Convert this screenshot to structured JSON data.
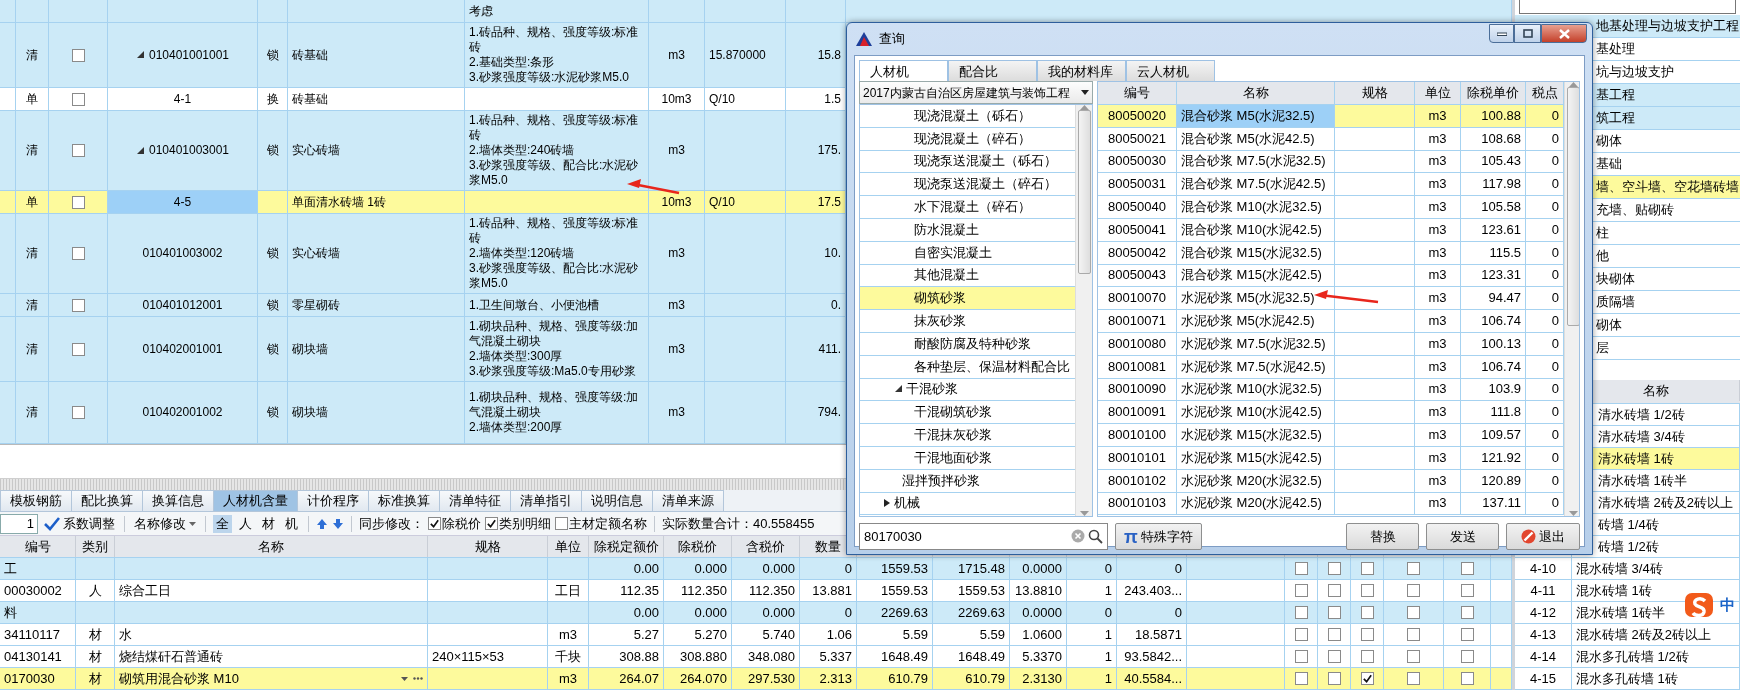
{
  "top_grid": {
    "rows": [
      {
        "kind": "bill",
        "selected": false,
        "features": [
          "考虑"
        ]
      },
      {
        "kind": "bill",
        "selected": false,
        "type": "清",
        "checked": false,
        "expanded": true,
        "code": "010401001001",
        "lock": "锁",
        "name": "砖基础",
        "features": [
          "1.砖品种、规格、强度等级:标准砖",
          "2.基础类型:条形",
          "3.砂浆强度等级:水泥砂浆M5.0"
        ],
        "unit": "m3",
        "expr": "15.870000",
        "qty": "15.8"
      },
      {
        "kind": "quota",
        "selected": false,
        "type": "单",
        "checked": false,
        "code": "4-1",
        "lock": "换",
        "name": "砖基础",
        "unit": "10m3",
        "expr": "Q/10",
        "qty": "1.5"
      },
      {
        "kind": "bill",
        "selected": false,
        "type": "清",
        "checked": false,
        "expanded": true,
        "code": "010401003001",
        "lock": "锁",
        "name": "实心砖墙",
        "features": [
          "1.砖品种、规格、强度等级:标准砖",
          "2.墙体类型:240砖墙",
          "3.砂浆强度等级、配合比:水泥砂浆M5.0"
        ],
        "unit": "m3",
        "qty": "175."
      },
      {
        "kind": "quota",
        "selected": true,
        "type": "单",
        "checked": false,
        "code": "4-5",
        "name": "单面清水砖墙 1砖",
        "unit": "10m3",
        "expr": "Q/10",
        "qty": "17.5"
      },
      {
        "kind": "bill",
        "selected": false,
        "type": "清",
        "checked": false,
        "expanded": false,
        "code": "010401003002",
        "lock": "锁",
        "name": "实心砖墙",
        "features": [
          "1.砖品种、规格、强度等级:标准砖",
          "2.墙体类型:120砖墙",
          "3.砂浆强度等级、配合比:水泥砂浆M5.0"
        ],
        "unit": "m3",
        "qty": "10."
      },
      {
        "kind": "bill",
        "selected": false,
        "type": "清",
        "checked": false,
        "expanded": false,
        "code": "010401012001",
        "lock": "锁",
        "name": "零星砌砖",
        "features": [
          "1.卫生间墩台、小便池槽"
        ],
        "unit": "m3",
        "qty": "0."
      },
      {
        "kind": "bill",
        "selected": false,
        "type": "清",
        "checked": false,
        "expanded": false,
        "code": "010402001001",
        "lock": "锁",
        "name": "砌块墙",
        "features": [
          "1.砌块品种、规格、强度等级:加气混凝土砌块",
          "2.墙体类型:300厚",
          "3.砂浆强度等级:Ma5.0专用砂浆"
        ],
        "unit": "m3",
        "qty": "411."
      },
      {
        "kind": "bill",
        "selected": false,
        "type": "清",
        "checked": false,
        "expanded": false,
        "code": "010402001002",
        "lock": "锁",
        "name": "砌块墙",
        "features": [
          "1.砌块品种、规格、强度等级:加气混凝土砌块",
          "2.墙体类型:200厚"
        ],
        "unit": "m3",
        "qty": "794."
      }
    ]
  },
  "bottom_tabs": [
    {
      "label": "模板钢筋",
      "selected": false
    },
    {
      "label": "配比换算",
      "selected": false
    },
    {
      "label": "换算信息",
      "selected": false
    },
    {
      "label": "人材机含量",
      "selected": true
    },
    {
      "label": "计价程序",
      "selected": false
    },
    {
      "label": "标准换算",
      "selected": false
    },
    {
      "label": "清单特征",
      "selected": false
    },
    {
      "label": "清单指引",
      "selected": false
    },
    {
      "label": "说明信息",
      "selected": false
    },
    {
      "label": "清单来源",
      "selected": false
    }
  ],
  "toolbar": {
    "coefficient": "1",
    "coefficient_button": "系数调整",
    "rename_menu": "名称修改",
    "filters": [
      {
        "label": "全",
        "selected": true
      },
      {
        "label": "人",
        "selected": false
      },
      {
        "label": "材",
        "selected": false
      },
      {
        "label": "机",
        "selected": false
      }
    ],
    "sync_label": "同步修改：",
    "sync_options": [
      {
        "label": "除税价",
        "checked": true
      },
      {
        "label": "类别明细",
        "checked": true
      },
      {
        "label": "主材定额名称",
        "checked": false
      }
    ],
    "total": "实际数量合计：40.558455"
  },
  "detail_table": {
    "columns": [
      "编号",
      "类别",
      "名称",
      "规格",
      "单位",
      "除税定额价",
      "除税价",
      "含税价",
      "数量"
    ],
    "rows": [
      {
        "kind": "group",
        "selected": false,
        "code": "工",
        "base_price": "0.00",
        "price": "0.000",
        "tax_price": "0.000",
        "qty": "0",
        "column_10": "1559.53",
        "column_11": "1715.48",
        "column_12": "0.0000",
        "column_13": "0",
        "column_14": "0",
        "checks": [
          false,
          false,
          false,
          false,
          false
        ]
      },
      {
        "kind": "item",
        "selected": false,
        "code": "00030002",
        "type": "人",
        "name": "综合工日",
        "unit": "工日",
        "base_price": "112.35",
        "price": "112.350",
        "tax_price": "112.350",
        "qty": "13.881",
        "column_10": "1559.53",
        "column_11": "1559.53",
        "column_12": "13.8810",
        "column_13": "1",
        "column_14": "243.403...",
        "checks": [
          false,
          false,
          false,
          false,
          false
        ]
      },
      {
        "kind": "group",
        "selected": false,
        "code": "料",
        "base_price": "0.00",
        "price": "0.000",
        "tax_price": "0.000",
        "qty": "0",
        "column_10": "2269.63",
        "column_11": "2269.63",
        "column_12": "0.0000",
        "column_13": "0",
        "column_14": "0",
        "checks": [
          false,
          false,
          false,
          false,
          false
        ]
      },
      {
        "kind": "item",
        "selected": false,
        "code": "34110117",
        "type": "材",
        "name": "水",
        "unit": "m3",
        "base_price": "5.27",
        "price": "5.270",
        "tax_price": "5.740",
        "qty": "1.06",
        "column_10": "5.59",
        "column_11": "5.59",
        "column_12": "1.0600",
        "column_13": "1",
        "column_14": "18.5871",
        "checks": [
          false,
          false,
          false,
          false,
          false
        ]
      },
      {
        "kind": "item",
        "selected": false,
        "code": "04130141",
        "type": "材",
        "name": "烧结煤矸石普通砖",
        "spec": "240×115×53",
        "unit": "千块",
        "base_price": "308.88",
        "price": "308.880",
        "tax_price": "348.080",
        "qty": "5.337",
        "column_10": "1648.49",
        "column_11": "1648.49",
        "column_12": "5.3370",
        "column_13": "1",
        "column_14": "93.5842...",
        "checks": [
          false,
          false,
          false,
          false,
          false
        ]
      },
      {
        "kind": "item",
        "selected": true,
        "code": "0170030",
        "type": "材",
        "name": "砌筑用混合砂浆 M10",
        "unit": "m3",
        "base_price": "264.07",
        "price": "264.070",
        "tax_price": "297.530",
        "qty": "2.313",
        "column_10": "610.79",
        "column_11": "610.79",
        "column_12": "2.3130",
        "column_13": "1",
        "column_14": "40.5584...",
        "checks": [
          false,
          false,
          true,
          false,
          false
        ]
      }
    ]
  },
  "side_tree": [
    {
      "kind": "chapter",
      "selected": false,
      "label": "地基处理与边坡支护工程"
    },
    {
      "kind": "item",
      "selected": false,
      "label": "基处理"
    },
    {
      "kind": "item",
      "selected": false,
      "label": "坑与边坡支护"
    },
    {
      "kind": "chapter",
      "selected": false,
      "label": "基工程"
    },
    {
      "kind": "chapter",
      "selected": false,
      "label": "筑工程"
    },
    {
      "kind": "item",
      "selected": false,
      "label": "砌体"
    },
    {
      "kind": "item",
      "selected": false,
      "label": "基础"
    },
    {
      "kind": "item",
      "selected": true,
      "label": "墙、空斗墙、空花墙砖墙"
    },
    {
      "kind": "item",
      "selected": false,
      "label": "充墙、贴砌砖"
    },
    {
      "kind": "item",
      "selected": false,
      "label": "柱"
    },
    {
      "kind": "item",
      "selected": false,
      "label": "他"
    },
    {
      "kind": "item",
      "selected": false,
      "label": "块砌体"
    },
    {
      "kind": "item",
      "selected": false,
      "label": "质隔墙"
    },
    {
      "kind": "item",
      "selected": false,
      "label": "砌体"
    },
    {
      "kind": "item",
      "selected": false,
      "label": "层"
    }
  ],
  "side_table": {
    "columns": [
      "名称"
    ],
    "rows": [
      {
        "selected": false,
        "name": "清水砖墙 1/2砖"
      },
      {
        "selected": false,
        "name": "清水砖墙 3/4砖"
      },
      {
        "selected": true,
        "name": "清水砖墙 1砖"
      },
      {
        "selected": false,
        "name": "清水砖墙 1砖半"
      },
      {
        "selected": false,
        "name": "清水砖墙 2砖及2砖以上"
      },
      {
        "selected": false,
        "name": "砖墙 1/4砖"
      },
      {
        "selected": false,
        "name": "砖墙 1/2砖"
      },
      {
        "selected": false,
        "code": "4-10",
        "name": "混水砖墙 3/4砖"
      },
      {
        "selected": false,
        "code": "4-11",
        "name": "混水砖墙 1砖"
      },
      {
        "selected": false,
        "code": "4-12",
        "name": "混水砖墙 1砖半"
      },
      {
        "selected": false,
        "code": "4-13",
        "name": "混水砖墙 2砖及2砖以上"
      },
      {
        "selected": false,
        "code": "4-14",
        "name": "混水多孔砖墙 1/2砖"
      },
      {
        "selected": false,
        "code": "4-15",
        "name": "混水多孔砖墙 1砖"
      }
    ]
  },
  "ime": {
    "mode": "中"
  },
  "dialog": {
    "title": "查询",
    "tabs": [
      {
        "label": "人材机",
        "selected": true
      },
      {
        "label": "配合比",
        "selected": false
      },
      {
        "label": "我的材料库",
        "selected": false
      },
      {
        "label": "云人材机",
        "selected": false
      }
    ],
    "library": "2017内蒙古自治区房屋建筑与装饰工程",
    "tree": [
      {
        "children": [
          {
            "children": [
              {
                "label": "现浇混凝土（砾石）",
                "selected": false
              },
              {
                "label": "现浇混凝土（碎石）",
                "selected": false
              },
              {
                "label": "现浇泵送混凝土（砾石）",
                "selected": false
              },
              {
                "label": "现浇泵送混凝土（碎石）",
                "selected": false
              },
              {
                "label": "水下混凝土（碎石）",
                "selected": false
              },
              {
                "label": "防水混凝土",
                "selected": false
              },
              {
                "label": "自密实混凝土",
                "selected": false
              },
              {
                "label": "其他混凝土",
                "selected": false
              },
              {
                "label": "砌筑砂浆",
                "selected": true
              },
              {
                "label": "抹灰砂浆",
                "selected": false
              },
              {
                "label": "耐酸防腐及特种砂浆",
                "selected": false
              },
              {
                "label": "各种垫层、保温材料配合比",
                "selected": false
              }
            ]
          },
          {
            "label": "干混砂浆",
            "selected": false,
            "expanded": true,
            "children": [
              {
                "label": "干混砌筑砂浆",
                "selected": false
              },
              {
                "label": "干混抹灰砂浆",
                "selected": false
              },
              {
                "label": "干混地面砂浆",
                "selected": false
              }
            ]
          },
          {
            "label": "湿拌预拌砂浆",
            "selected": false
          }
        ]
      },
      {
        "label": "机械",
        "selected": false,
        "expanded": false
      }
    ],
    "table": {
      "columns": [
        "编号",
        "名称",
        "规格",
        "单位",
        "除税单价",
        "税点"
      ],
      "rows": [
        {
          "selected": true,
          "code": "80050020",
          "name": "混合砂浆 M5(水泥32.5)",
          "unit": "m3",
          "price": "100.88",
          "tax": "0"
        },
        {
          "selected": false,
          "code": "80050021",
          "name": "混合砂浆 M5(水泥42.5)",
          "unit": "m3",
          "price": "108.68",
          "tax": "0"
        },
        {
          "selected": false,
          "code": "80050030",
          "name": "混合砂浆 M7.5(水泥32.5)",
          "unit": "m3",
          "price": "105.43",
          "tax": "0"
        },
        {
          "selected": false,
          "code": "80050031",
          "name": "混合砂浆 M7.5(水泥42.5)",
          "unit": "m3",
          "price": "117.98",
          "tax": "0"
        },
        {
          "selected": false,
          "code": "80050040",
          "name": "混合砂浆 M10(水泥32.5)",
          "unit": "m3",
          "price": "105.58",
          "tax": "0"
        },
        {
          "selected": false,
          "code": "80050041",
          "name": "混合砂浆 M10(水泥42.5)",
          "unit": "m3",
          "price": "123.61",
          "tax": "0"
        },
        {
          "selected": false,
          "code": "80050042",
          "name": "混合砂浆 M15(水泥32.5)",
          "unit": "m3",
          "price": "115.5",
          "tax": "0"
        },
        {
          "selected": false,
          "code": "80050043",
          "name": "混合砂浆 M15(水泥42.5)",
          "unit": "m3",
          "price": "123.31",
          "tax": "0"
        },
        {
          "selected": false,
          "code": "80010070",
          "name": "水泥砂浆 M5(水泥32.5)",
          "unit": "m3",
          "price": "94.47",
          "tax": "0"
        },
        {
          "selected": false,
          "code": "80010071",
          "name": "水泥砂浆 M5(水泥42.5)",
          "unit": "m3",
          "price": "106.74",
          "tax": "0"
        },
        {
          "selected": false,
          "code": "80010080",
          "name": "水泥砂浆 M7.5(水泥32.5)",
          "unit": "m3",
          "price": "100.13",
          "tax": "0"
        },
        {
          "selected": false,
          "code": "80010081",
          "name": "水泥砂浆 M7.5(水泥42.5)",
          "unit": "m3",
          "price": "106.74",
          "tax": "0"
        },
        {
          "selected": false,
          "code": "80010090",
          "name": "水泥砂浆 M10(水泥32.5)",
          "unit": "m3",
          "price": "103.9",
          "tax": "0"
        },
        {
          "selected": false,
          "code": "80010091",
          "name": "水泥砂浆 M10(水泥42.5)",
          "unit": "m3",
          "price": "111.8",
          "tax": "0"
        },
        {
          "selected": false,
          "code": "80010100",
          "name": "水泥砂浆 M15(水泥32.5)",
          "unit": "m3",
          "price": "109.57",
          "tax": "0"
        },
        {
          "selected": false,
          "code": "80010101",
          "name": "水泥砂浆 M15(水泥42.5)",
          "unit": "m3",
          "price": "121.92",
          "tax": "0"
        },
        {
          "selected": false,
          "code": "80010102",
          "name": "水泥砂浆 M20(水泥32.5)",
          "unit": "m3",
          "price": "120.89",
          "tax": "0"
        },
        {
          "selected": false,
          "code": "80010103",
          "name": "水泥砂浆 M20(水泥42.5)",
          "unit": "m3",
          "price": "137.11",
          "tax": "0"
        }
      ]
    },
    "search": {
      "value": "80170030"
    },
    "special_chars": {
      "symbol": "π",
      "label": "特殊字符"
    },
    "buttons": [
      {
        "kind": "replace",
        "label": "替换"
      },
      {
        "kind": "send",
        "label": "发送"
      },
      {
        "kind": "exit",
        "label": "退出"
      }
    ]
  }
}
